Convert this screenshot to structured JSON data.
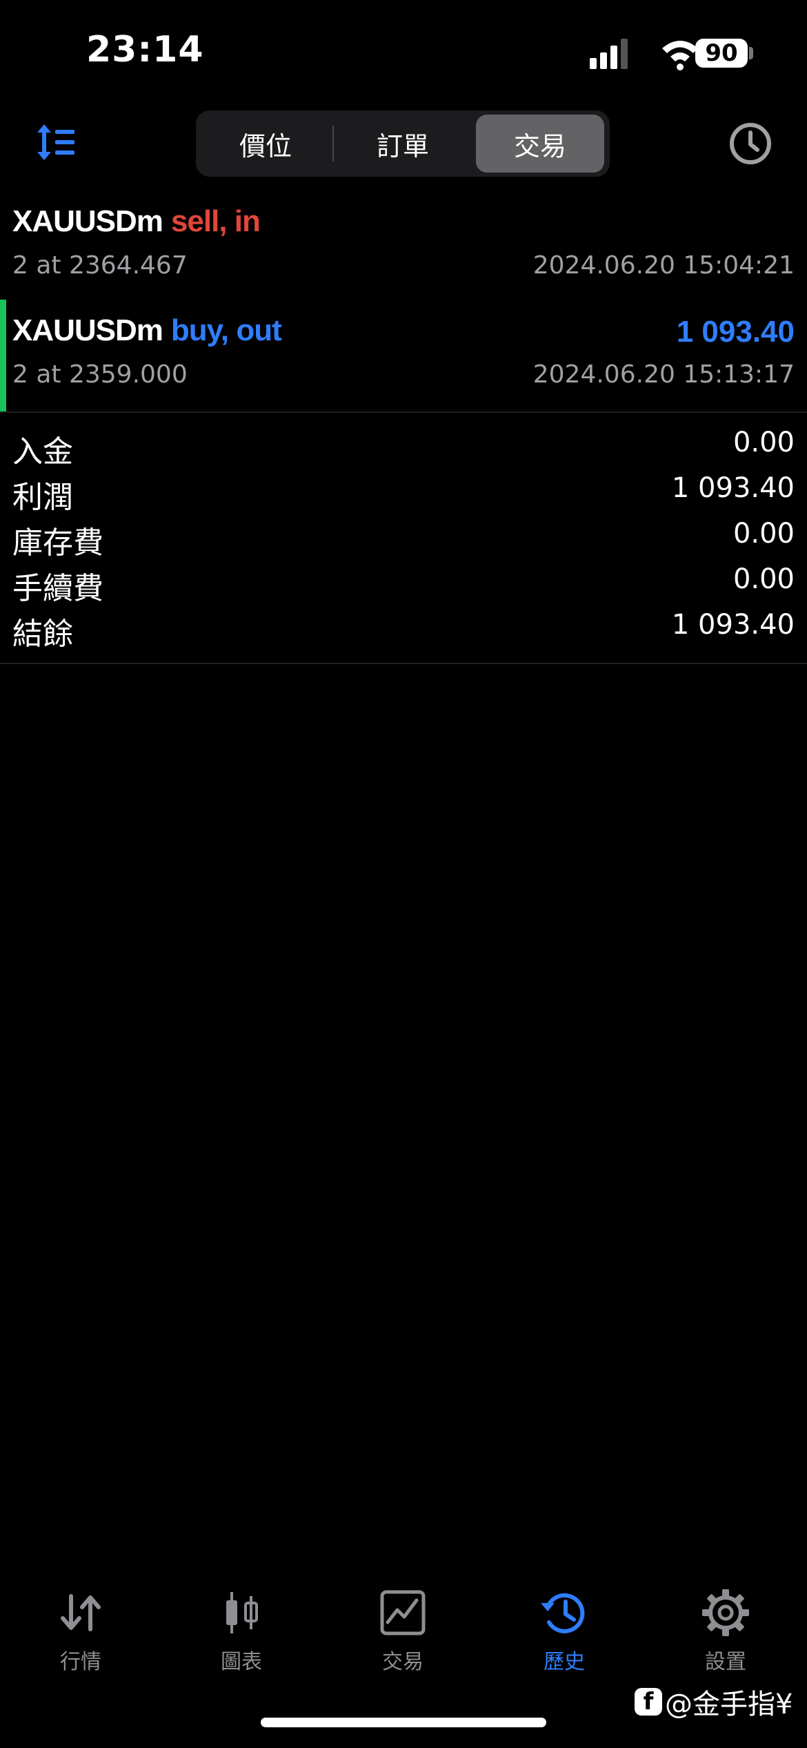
{
  "status_bar": {
    "time": "23:14",
    "battery": "90"
  },
  "header": {
    "segments": [
      "價位",
      "訂單",
      "交易"
    ],
    "active_segment": "交易"
  },
  "deals": [
    {
      "symbol": "XAUUSDm",
      "type": "sell, in",
      "type_color": "#e0463a",
      "sub": "2 at 2364.467",
      "time": "2024.06.20 15:04:21",
      "profit": ""
    },
    {
      "symbol": "XAUUSDm",
      "type": "buy, out",
      "type_color": "#2f7dfb",
      "sub": "2 at 2359.000",
      "time": "2024.06.20 15:13:17",
      "profit": "1 093.40"
    }
  ],
  "summary": [
    {
      "label": "入金",
      "value": "0.00"
    },
    {
      "label": "利潤",
      "value": "1 093.40"
    },
    {
      "label": "庫存費",
      "value": "0.00"
    },
    {
      "label": "手續費",
      "value": "0.00"
    },
    {
      "label": "結餘",
      "value": "1 093.40"
    }
  ],
  "tabbar": [
    {
      "label": "行情",
      "icon": "quotes-arrows-icon"
    },
    {
      "label": "圖表",
      "icon": "candlestick-chart-icon"
    },
    {
      "label": "交易",
      "icon": "trade-chart-icon"
    },
    {
      "label": "歷史",
      "icon": "history-clock-icon"
    },
    {
      "label": "設置",
      "icon": "gear-icon"
    }
  ],
  "active_tab": "歷史",
  "watermark": "@金手指¥",
  "colors": {
    "accent_blue": "#2f7dfb",
    "sell_red": "#e0463a",
    "profit_green_bar": "#19c25a"
  }
}
